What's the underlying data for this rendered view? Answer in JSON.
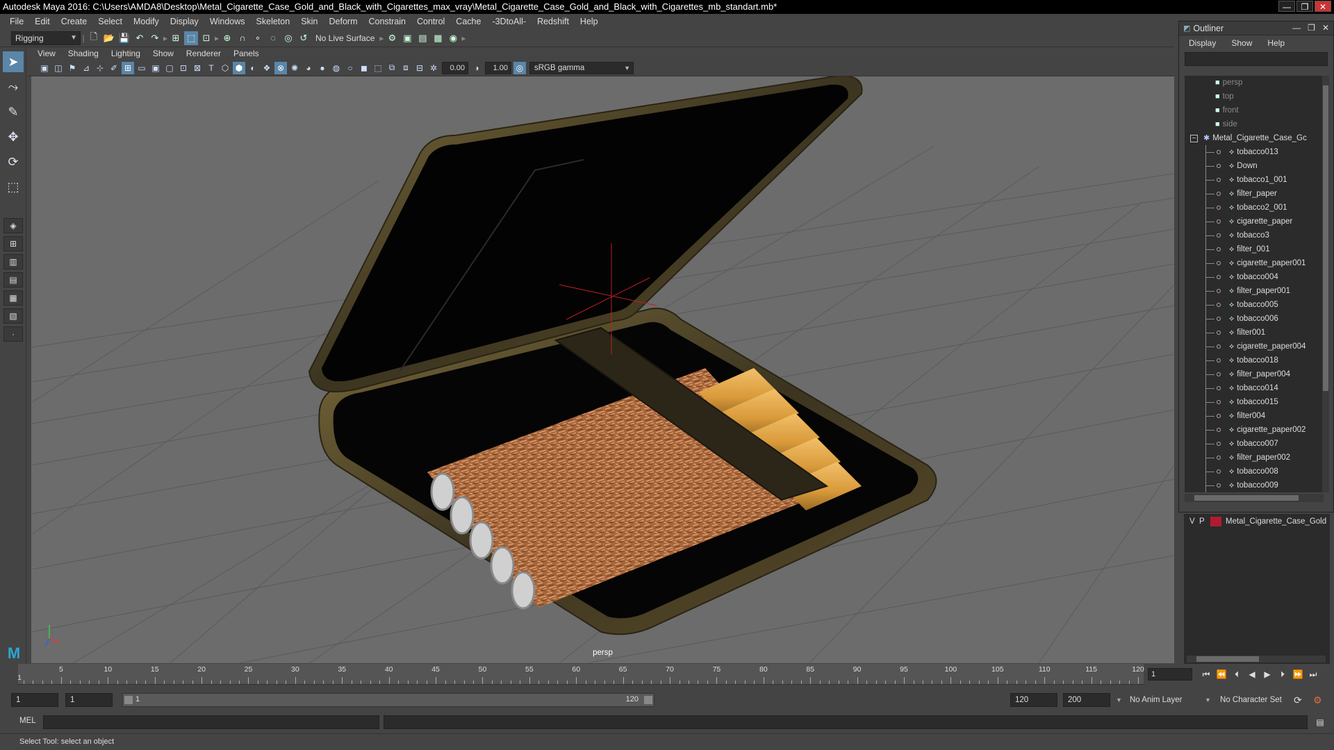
{
  "window": {
    "title": "Autodesk Maya 2016: C:\\Users\\AMDA8\\Desktop\\Metal_Cigarette_Case_Gold_and_Black_with_Cigarettes_max_vray\\Metal_Cigarette_Case_Gold_and_Black_with_Cigarettes_mb_standart.mb*"
  },
  "menubar": [
    "File",
    "Edit",
    "Create",
    "Select",
    "Modify",
    "Display",
    "Windows",
    "Skeleton",
    "Skin",
    "Deform",
    "Constrain",
    "Control",
    "Cache",
    "-3DtoAll-",
    "Redshift",
    "Help"
  ],
  "shelf": {
    "mode": "Rigging",
    "live_surface": "No Live Surface"
  },
  "viewport": {
    "menu": [
      "View",
      "Shading",
      "Lighting",
      "Show",
      "Renderer",
      "Panels"
    ],
    "exposure": "0.00",
    "gamma": "1.00",
    "colorspace": "sRGB gamma",
    "camera_label": "persp",
    "background_color": "#6c6c6c"
  },
  "outliner": {
    "title": "Outliner",
    "menu": [
      "Display",
      "Show",
      "Help"
    ],
    "cameras": [
      "persp",
      "top",
      "front",
      "side"
    ],
    "group": "Metal_Cigarette_Case_Gc",
    "children": [
      "tobacco013",
      "Down",
      "tobacco1_001",
      "filter_paper",
      "tobacco2_001",
      "cigarette_paper",
      "tobacco3",
      "filter_001",
      "cigarette_paper001",
      "tobacco004",
      "filter_paper001",
      "tobacco005",
      "tobacco006",
      "filter001",
      "cigarette_paper004",
      "tobacco018",
      "filter_paper004",
      "tobacco014",
      "tobacco015",
      "filter004",
      "cigarette_paper002",
      "tobacco007",
      "filter_paper002",
      "tobacco008",
      "tobacco009"
    ]
  },
  "layers": {
    "rows": [
      {
        "v": "V",
        "p": "P",
        "name": "Metal_Cigarette_Case_Gold",
        "color": "#b01c2e"
      }
    ]
  },
  "timeline": {
    "ticks": [
      "5",
      "10",
      "15",
      "20",
      "25",
      "30",
      "35",
      "40",
      "45",
      "50",
      "55",
      "60",
      "65",
      "70",
      "75",
      "80",
      "85",
      "90",
      "95",
      "100",
      "105",
      "110",
      "115",
      "120"
    ],
    "start_label": "1",
    "current_frame": "1"
  },
  "range": {
    "start": "1",
    "inner_start": "1",
    "slider_start": "1",
    "slider_end": "120",
    "end": "120",
    "max": "200",
    "anim_layer": "No Anim Layer",
    "char_set": "No Character Set"
  },
  "cmdline": {
    "label": "MEL"
  },
  "helpline": {
    "text": "Select Tool: select an object"
  }
}
